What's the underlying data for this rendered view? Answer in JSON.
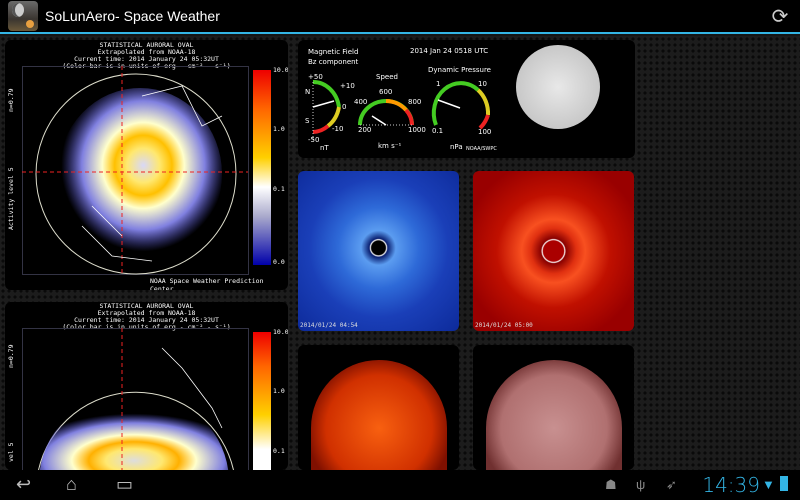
{
  "app": {
    "title": "SoLunAero- Space Weather",
    "refresh_icon": "refresh-icon"
  },
  "aurora": [
    {
      "title1": "STATISTICAL AURORAL OVAL",
      "title2": "Extrapolated from NOAA-18",
      "title3": "Current time: 2014 January 24 05:32UT",
      "title4": "(Color bar is in units of erg - cm⁻² - s⁻¹)",
      "side_left": "Activity level 5",
      "side_right": "n=0.79",
      "cb_max": "10.0",
      "cb_1": "1.0",
      "cb_01": "0.1",
      "cb_min": "0.0",
      "credit": "NOAA Space Weather Prediction Center"
    },
    {
      "title1": "STATISTICAL AURORAL OVAL",
      "title2": "Extrapolated from NOAA-18",
      "title3": "Current time: 2014 January 24 05:32UT",
      "title4": "(Color bar is in units of erg - cm⁻² - s⁻¹)",
      "side_left": "vel 5",
      "side_right": "n=0.79",
      "cb_max": "10.0",
      "cb_1": "1.0",
      "cb_01": "0.1"
    }
  ],
  "gauges": {
    "date": "2014 Jan 24 0518 UTC",
    "mag_title": "Magnetic Field",
    "mag_sub": "Bz component",
    "mag_ticks": [
      "+50",
      "+10",
      "0",
      "-10",
      "-50"
    ],
    "mag_n": "N",
    "mag_s": "S",
    "mag_unit": "nT",
    "speed_title": "Speed",
    "speed_ticks": [
      "200",
      "400",
      "600",
      "800",
      "1000"
    ],
    "speed_unit": "km s⁻¹",
    "press_title": "Dynamic Pressure",
    "press_ticks": [
      "0.1",
      "1",
      "10",
      "100"
    ],
    "press_unit": "nPa",
    "credit": "NOAA/SWPC"
  },
  "images": [
    {
      "name": "lasco-c3",
      "timestamp": "2014/01/24 04:54"
    },
    {
      "name": "lasco-c2",
      "timestamp": "2014/01/24 05:00"
    }
  ],
  "status": {
    "time": "14:39"
  }
}
